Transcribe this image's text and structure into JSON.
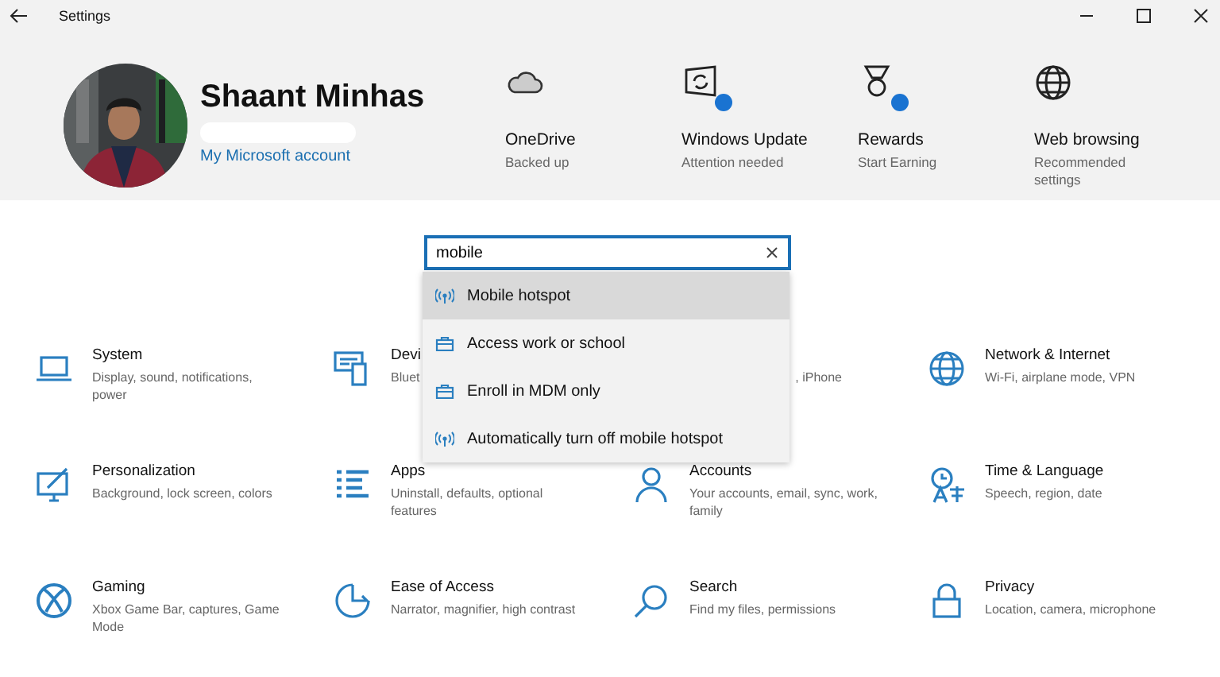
{
  "window": {
    "title": "Settings"
  },
  "profile": {
    "name": "Shaant Minhas",
    "link": "My Microsoft account"
  },
  "status_items": [
    {
      "title": "OneDrive",
      "subtitle": "Backed up",
      "badge": false
    },
    {
      "title": "Windows Update",
      "subtitle": "Attention needed",
      "badge": true
    },
    {
      "title": "Rewards",
      "subtitle": "Start Earning",
      "badge": true
    },
    {
      "title": "Web browsing",
      "subtitle": "Recommended settings",
      "badge": false
    }
  ],
  "search": {
    "value": "mobile",
    "results": [
      {
        "label": "Mobile hotspot",
        "selected": true
      },
      {
        "label": "Access work or school",
        "selected": false
      },
      {
        "label": "Enroll in MDM only",
        "selected": false
      },
      {
        "label": "Automatically turn off mobile hotspot",
        "selected": false
      }
    ]
  },
  "categories": [
    {
      "title": "System",
      "description": "Display, sound, notifications, power"
    },
    {
      "title": "Devi",
      "description": "Bluet"
    },
    {
      "description": ", iPhone"
    },
    {
      "title": "Network & Internet",
      "description": "Wi-Fi, airplane mode, VPN"
    },
    {
      "title": "Personalization",
      "description": "Background, lock screen, colors"
    },
    {
      "title": "Apps",
      "description": "Uninstall, defaults, optional features"
    },
    {
      "title": "Accounts",
      "description": "Your accounts, email, sync, work, family"
    },
    {
      "title": "Time & Language",
      "description": "Speech, region, date"
    },
    {
      "title": "Gaming",
      "description": "Xbox Game Bar, captures, Game Mode"
    },
    {
      "title": "Ease of Access",
      "description": "Narrator, magnifier, high contrast"
    },
    {
      "title": "Search",
      "description": "Find my files, permissions"
    },
    {
      "title": "Privacy",
      "description": "Location, camera, microphone"
    }
  ]
}
